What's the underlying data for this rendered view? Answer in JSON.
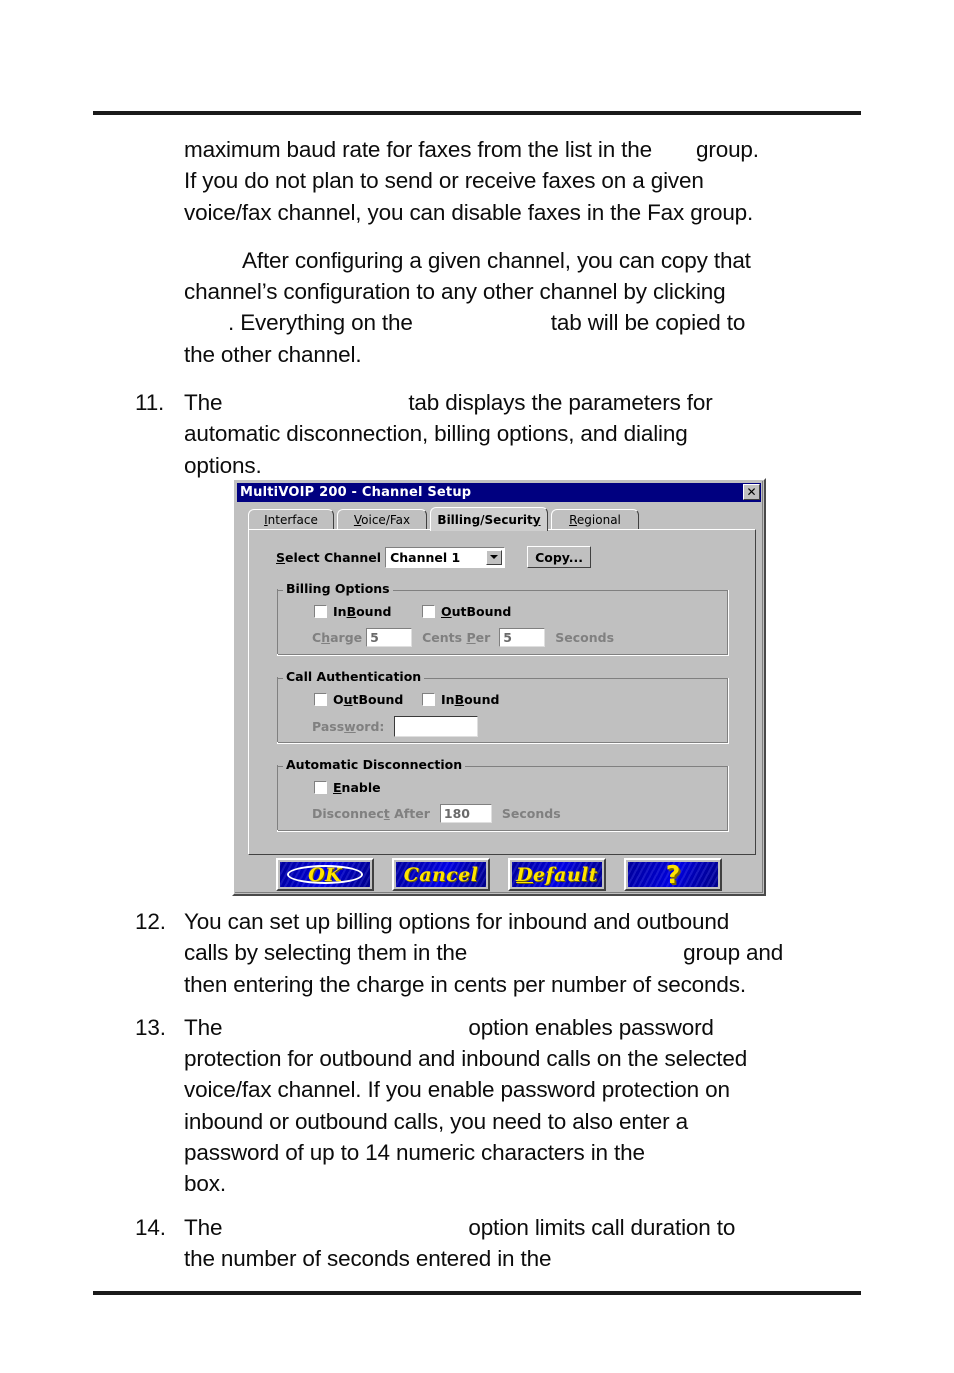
{
  "document": {
    "paragraphs": [
      {
        "id": "p-fax",
        "lines": [
          "maximum baud rate for faxes from the list in the",
          "group.",
          "If you do not plan to send or receive faxes on a given",
          "voice/fax channel, you can disable faxes in the Fax group."
        ],
        "text_a": "maximum baud rate for faxes from the list in the",
        "text_b": "group.",
        "text_c": "If you do not plan to send or receive faxes on a given",
        "text_d": "voice/fax channel, you can disable faxes in the Fax group."
      },
      {
        "id": "p-copy",
        "text_a": "After configuring a given channel, you can copy that",
        "text_b": "channel’s configuration to any other channel by clicking",
        "text_c": ".  Everything on the",
        "text_d": "tab will be copied to",
        "text_e": "the other channel."
      }
    ],
    "list_items": [
      {
        "number": "11.",
        "text_a": "The",
        "text_b": "tab displays the parameters for",
        "text_c": "automatic disconnection, billing options, and dialing",
        "text_d": "options."
      },
      {
        "number": "12.",
        "text_a": "You can set up billing options for inbound and outbound",
        "text_b": "calls by selecting them in the",
        "text_c": "group and",
        "text_d": "then entering the charge in cents per number of seconds."
      },
      {
        "number": "13.",
        "text_a": "The",
        "text_b": "option enables password",
        "text_c": "protection for outbound and inbound calls on the selected",
        "text_d": "voice/fax channel.  If you enable password protection on",
        "text_e": "inbound or outbound calls, you need to also enter a",
        "text_f": "password of up to 14 numeric characters in the",
        "text_g": "box."
      },
      {
        "number": "14.",
        "text_a": "The",
        "text_b": "option limits call duration to",
        "text_c": "the number of seconds entered in the"
      }
    ]
  },
  "dialog": {
    "title": "MultiVOIP 200 - Channel Setup",
    "close_glyph": "✕",
    "titlebar_color": "#000080",
    "face_color": "#c0c0c0",
    "tabs": [
      {
        "label": "Interface",
        "accel": "I",
        "active": false
      },
      {
        "label": "Voice/Fax",
        "accel": "V",
        "active": false
      },
      {
        "label": "Billing/Security",
        "accel": "y",
        "active": true
      },
      {
        "label": "Regional",
        "accel": "R",
        "active": false
      }
    ],
    "select_channel": {
      "label_pre": "S",
      "label_post": "elect Channel",
      "value": "Channel 1",
      "arrow_icon": "chevron-down-icon"
    },
    "copy_button": {
      "label": "Copy..."
    },
    "billing_options": {
      "legend": "Billing Options",
      "checkbox_inbound": {
        "label_a": "In",
        "label_accel": "B",
        "label_b": "ound",
        "checked": false
      },
      "checkbox_outbound": {
        "label_a": "",
        "label_accel": "O",
        "label_b": "utBound",
        "checked": false
      },
      "charge_label_a": "C",
      "charge_label_accel": "h",
      "charge_label_b": "arge",
      "charge_value": "5",
      "cents_label_a": "Cents ",
      "cents_label_accel": "P",
      "cents_label_b": "er",
      "cents_value": "5",
      "seconds_label": "Seconds"
    },
    "call_authentication": {
      "legend": "Call Authentication",
      "checkbox_outbound": {
        "label_a": "O",
        "label_accel": "u",
        "label_b": "tBound",
        "checked": false
      },
      "checkbox_inbound": {
        "label_a": "In",
        "label_accel": "B",
        "label_b": "ound",
        "checked": false
      },
      "password_label_a": "Pass",
      "password_label_accel": "w",
      "password_label_b": "ord:",
      "password_value": ""
    },
    "automatic_disconnection": {
      "legend": "Automatic Disconnection",
      "checkbox_enable": {
        "label_a": "",
        "label_accel": "E",
        "label_b": "nable",
        "checked": false
      },
      "disconnect_label_a": "Disconnec",
      "disconnect_label_accel": "t",
      "disconnect_label_b": " After",
      "disconnect_value": "180",
      "seconds_label": "Seconds"
    },
    "buttons": [
      {
        "name": "ok",
        "label": "OK",
        "accel": "",
        "style": "oval"
      },
      {
        "name": "cancel",
        "label": "Cancel",
        "accel": "",
        "style": "plain"
      },
      {
        "name": "default",
        "label": "Default",
        "accel": "D",
        "style": "plain"
      },
      {
        "name": "help",
        "label": "?",
        "accel": "",
        "style": "qmark"
      }
    ],
    "button_face_color": "#0000c8",
    "button_text_color": "#ffe400"
  }
}
